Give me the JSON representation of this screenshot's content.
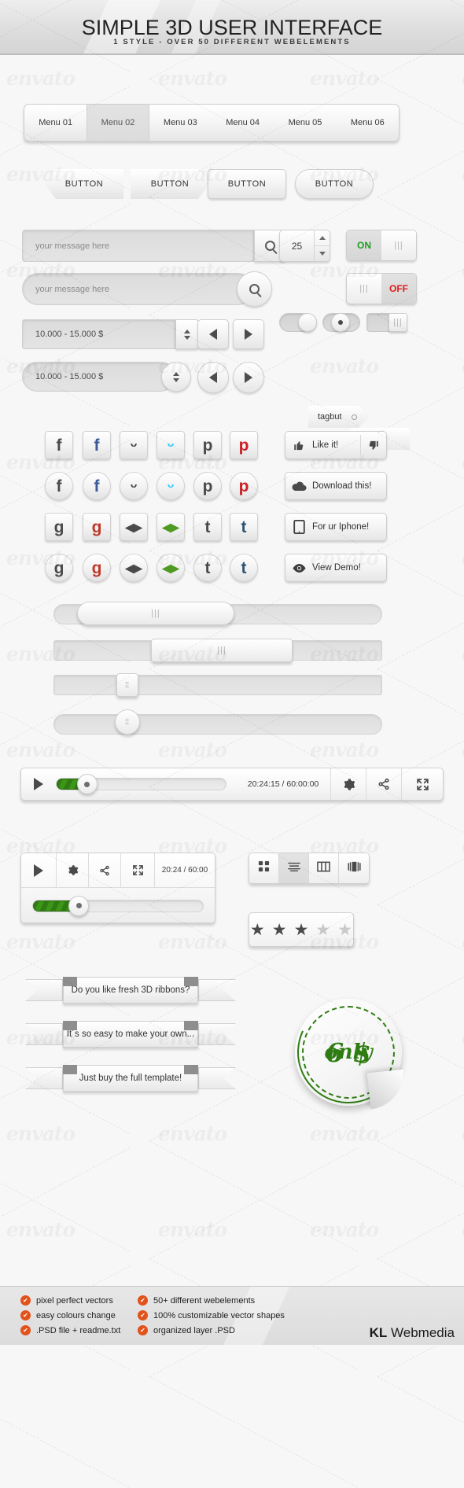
{
  "header": {
    "title": "SIMPLE 3D USER INTERFACE",
    "subtitle": "1 STYLE - OVER 50 DIFFERENT WEBELEMENTS"
  },
  "watermark": {
    "text": "envato"
  },
  "menu": {
    "items": [
      {
        "label": "Menu 01",
        "active": false
      },
      {
        "label": "Menu 02",
        "active": true
      },
      {
        "label": "Menu 03",
        "active": false
      },
      {
        "label": "Menu 04",
        "active": false
      },
      {
        "label": "Menu 05",
        "active": false
      },
      {
        "label": "Menu 06",
        "active": false
      }
    ]
  },
  "buttons": {
    "arrow_left": "BUTTON",
    "arrow_right": "BUTTON",
    "rect": "BUTTON",
    "pill": "BUTTON"
  },
  "search": {
    "rect_value": "your message here",
    "round_value": "your message here",
    "icon": "search-icon"
  },
  "spinner": {
    "value": "25"
  },
  "toggles": {
    "on_label": "ON",
    "off_label": "OFF",
    "grip": "|||"
  },
  "price": {
    "rect_value": "10.000 - 15.000 $",
    "round_value": "10.000 - 15.000 $"
  },
  "tags": {
    "tag_right": "tagbut",
    "tag_left": "tagbut"
  },
  "social": {
    "rows": [
      {
        "shape": "square",
        "items": [
          {
            "name": "facebook-icon",
            "glyph": "f",
            "color": "#4a4a4a"
          },
          {
            "name": "facebook-icon",
            "glyph": "f",
            "color": "#3b5998"
          },
          {
            "name": "twitter-icon",
            "glyph": "ᵕ",
            "color": "#4a4a4a"
          },
          {
            "name": "twitter-icon",
            "glyph": "ᵕ",
            "color": "#32ccfe"
          },
          {
            "name": "pinterest-icon",
            "glyph": "р",
            "color": "#4a4a4a"
          },
          {
            "name": "pinterest-icon",
            "glyph": "р",
            "color": "#cb2027"
          }
        ]
      },
      {
        "shape": "circle",
        "items": [
          {
            "name": "facebook-icon",
            "glyph": "f",
            "color": "#4a4a4a"
          },
          {
            "name": "facebook-icon",
            "glyph": "f",
            "color": "#3b5998"
          },
          {
            "name": "twitter-icon",
            "glyph": "ᵕ",
            "color": "#4a4a4a"
          },
          {
            "name": "twitter-icon",
            "glyph": "ᵕ",
            "color": "#32ccfe"
          },
          {
            "name": "pinterest-icon",
            "glyph": "р",
            "color": "#4a4a4a"
          },
          {
            "name": "pinterest-icon",
            "glyph": "р",
            "color": "#cb2027"
          }
        ]
      },
      {
        "shape": "square",
        "items": [
          {
            "name": "google-icon",
            "glyph": "g",
            "color": "#4a4a4a"
          },
          {
            "name": "google-icon",
            "glyph": "g",
            "color": "#c0392b"
          },
          {
            "name": "deviantart-icon",
            "glyph": "◂▸",
            "color": "#4a4a4a"
          },
          {
            "name": "deviantart-icon",
            "glyph": "◂▸",
            "color": "#4e9a22"
          },
          {
            "name": "tumblr-icon",
            "glyph": "t",
            "color": "#4a4a4a"
          },
          {
            "name": "tumblr-icon",
            "glyph": "t",
            "color": "#2c5472"
          }
        ]
      },
      {
        "shape": "circle",
        "items": [
          {
            "name": "google-icon",
            "glyph": "g",
            "color": "#4a4a4a"
          },
          {
            "name": "google-icon",
            "glyph": "g",
            "color": "#c0392b"
          },
          {
            "name": "deviantart-icon",
            "glyph": "◂▸",
            "color": "#4a4a4a"
          },
          {
            "name": "deviantart-icon",
            "glyph": "◂▸",
            "color": "#4e9a22"
          },
          {
            "name": "tumblr-icon",
            "glyph": "t",
            "color": "#4a4a4a"
          },
          {
            "name": "tumblr-icon",
            "glyph": "t",
            "color": "#2c5472"
          }
        ]
      }
    ]
  },
  "actions": {
    "like": "Like it!",
    "download": "Download this!",
    "iphone": "For ur Iphone!",
    "demo": "View Demo!"
  },
  "player_large": {
    "time": "20:24:15 / 60:00:00",
    "progress_percent": 18
  },
  "player_small": {
    "time": "20:24 / 60:00",
    "progress_percent": 27
  },
  "view_modes": [
    {
      "name": "grid-view-icon",
      "active": false
    },
    {
      "name": "list-view-icon",
      "active": true
    },
    {
      "name": "column-view-icon",
      "active": false
    },
    {
      "name": "coverflow-view-icon",
      "active": false
    }
  ],
  "rating": {
    "filled": 3,
    "total": 5
  },
  "ribbons": [
    "Do you like fresh 3D ribbons?",
    "It´s so easy to make your own...",
    "Just buy the full template!"
  ],
  "sticker": {
    "price": "6 $",
    "only": "only"
  },
  "footer": {
    "left_items": [
      "pixel perfect vectors",
      "easy colours change",
      ".PSD file + readme.txt"
    ],
    "right_items": [
      "50+ different webelements",
      "100% customizable vector shapes",
      "organized layer .PSD"
    ],
    "check_glyph": "✔",
    "brand_bold": "KL",
    "brand_rest": " Webmedia"
  },
  "colors": {
    "green": "#2f7d12",
    "red": "#e01b1b",
    "orange": "#e2521b"
  }
}
